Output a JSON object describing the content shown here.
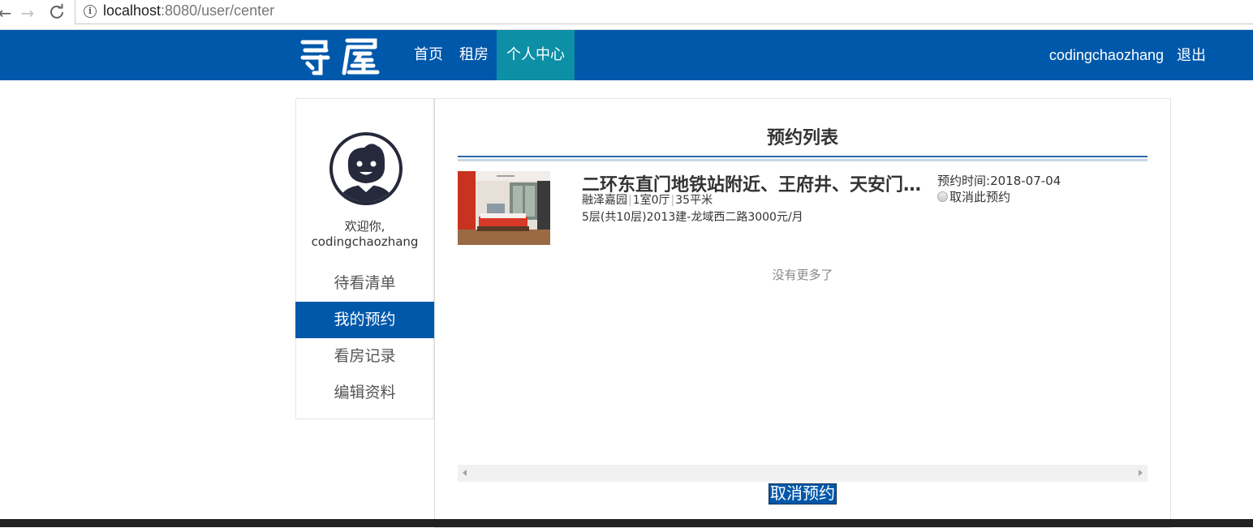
{
  "browser": {
    "url_host": "localhost",
    "url_rest": ":8080/user/center"
  },
  "header": {
    "logo_text": "寻屋",
    "nav": [
      "首页",
      "租房",
      "个人中心"
    ],
    "username": "codingchaozhang",
    "logout": "退出",
    "colors": {
      "bar": "#0058aa",
      "active_tab": "#0d8fa6"
    }
  },
  "sidebar": {
    "welcome_line1": "欢迎你,",
    "welcome_line2": "codingchaozhang",
    "menu": [
      "待看清单",
      "我的预约",
      "看房记录",
      "编辑资料"
    ],
    "active_index": 1
  },
  "main": {
    "title": "预约列表",
    "item": {
      "title": "二环东直门地铁站附近、王府井、天安门、北京站",
      "community": "融泽嘉园",
      "layout": "1室0厅",
      "area": "35平米",
      "detail": "5层(共10层)2013建-龙域西二路3000元/月",
      "appointment_label": "预约时间:",
      "appointment_date": "2018-07-04",
      "cancel_option": "取消此预约"
    },
    "no_more": "没有更多了",
    "cancel_button": "取消预约"
  }
}
